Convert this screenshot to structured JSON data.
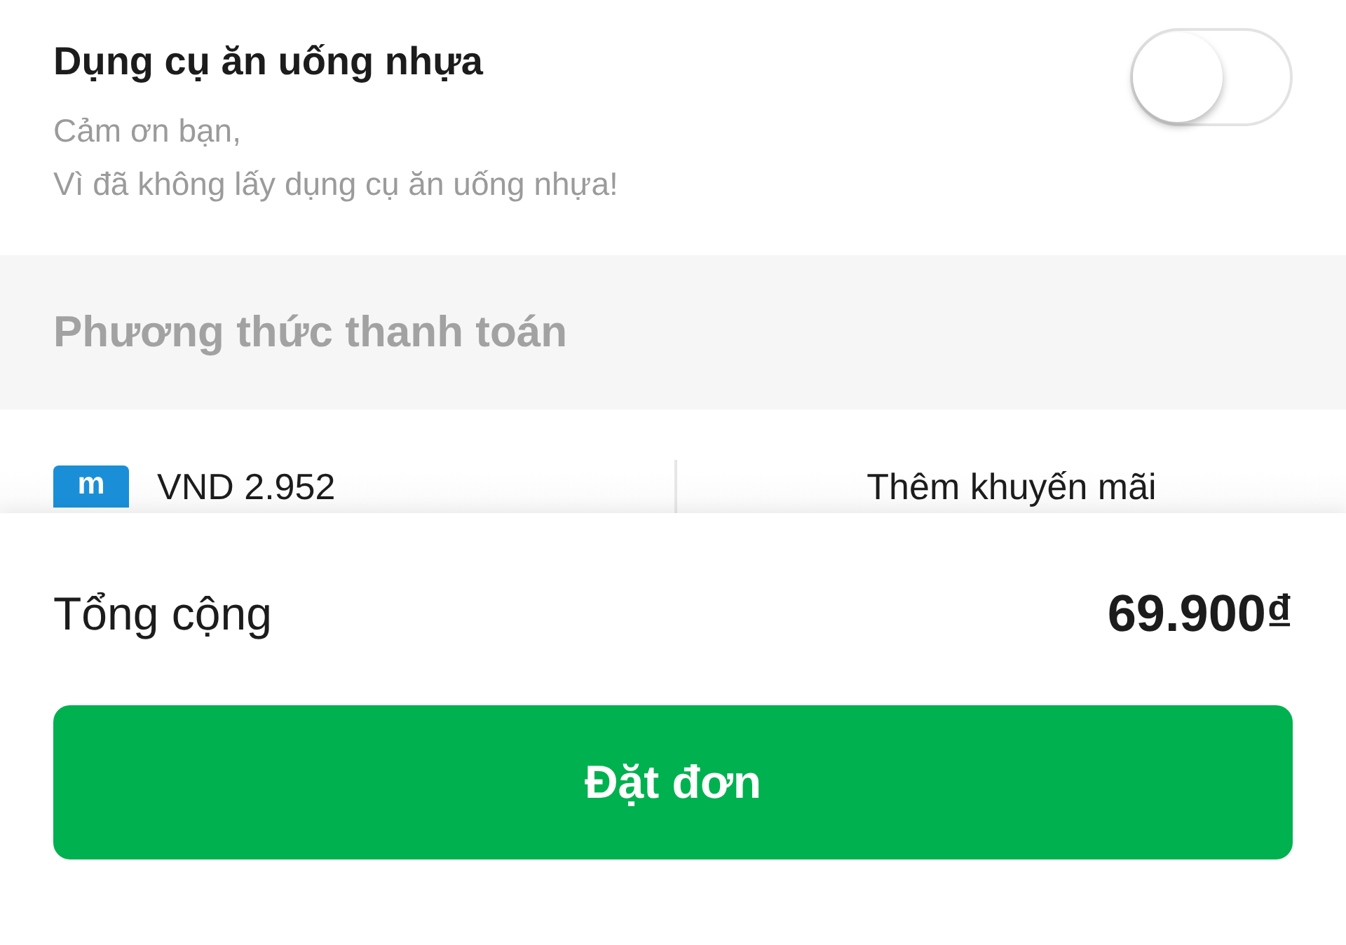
{
  "utensils": {
    "title": "Dụng cụ ăn uống nhựa",
    "message": "Cảm ơn bạn,\nVì đã không lấy dụng cụ ăn uống nhựa!",
    "toggle": {
      "on": false
    }
  },
  "payment_section": {
    "heading": "Phương thức thanh toán"
  },
  "payment_row": {
    "wallet_logo": "m",
    "balance": "VND 2.952",
    "promo": "Thêm khuyến mãi"
  },
  "summary": {
    "label": "Tổng cộng",
    "total": "69.900₫"
  },
  "order_button": {
    "label": "Đặt đơn"
  }
}
